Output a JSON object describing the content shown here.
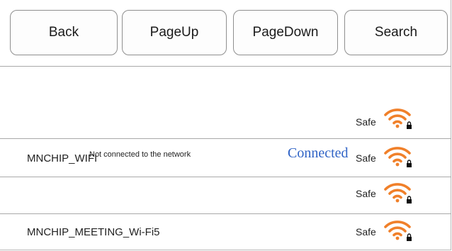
{
  "toolbar": {
    "back_label": "Back",
    "pageup_label": "PageUp",
    "pagedown_label": "PageDown",
    "search_label": "Search"
  },
  "status_text": "Not connected to the network",
  "networks": [
    {
      "ssid": "",
      "security": "Safe",
      "signal_icon": "wifi-locked-icon"
    },
    {
      "ssid": "MNCHIP_WIFI",
      "security": "Safe",
      "signal_icon": "wifi-locked-icon"
    },
    {
      "ssid": "",
      "security": "Safe",
      "signal_icon": "wifi-locked-icon"
    },
    {
      "ssid": "MNCHIP_MEETING_Wi-Fi5",
      "security": "Safe",
      "signal_icon": "wifi-locked-icon"
    }
  ],
  "connected_label": "Connected",
  "colors": {
    "wifi_orange": "#f0802a",
    "connected_blue": "#2f63c6",
    "divider": "#a9a9a9"
  }
}
